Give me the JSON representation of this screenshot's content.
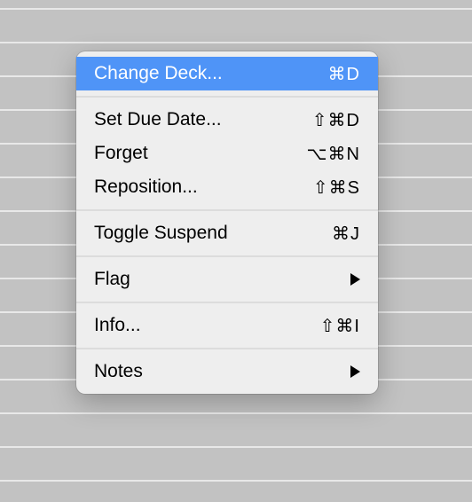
{
  "menu": {
    "groups": [
      [
        {
          "id": "change-deck",
          "label": "Change Deck...",
          "shortcut": "⌘D",
          "highlighted": true
        }
      ],
      [
        {
          "id": "set-due-date",
          "label": "Set Due Date...",
          "shortcut": "⇧⌘D"
        },
        {
          "id": "forget",
          "label": "Forget",
          "shortcut": "⌥⌘N"
        },
        {
          "id": "reposition",
          "label": "Reposition...",
          "shortcut": "⇧⌘S"
        }
      ],
      [
        {
          "id": "toggle-suspend",
          "label": "Toggle Suspend",
          "shortcut": "⌘J"
        }
      ],
      [
        {
          "id": "flag",
          "label": "Flag",
          "submenu": true
        }
      ],
      [
        {
          "id": "info",
          "label": "Info...",
          "shortcut": "⇧⌘I"
        }
      ],
      [
        {
          "id": "notes",
          "label": "Notes",
          "submenu": true
        }
      ]
    ]
  }
}
